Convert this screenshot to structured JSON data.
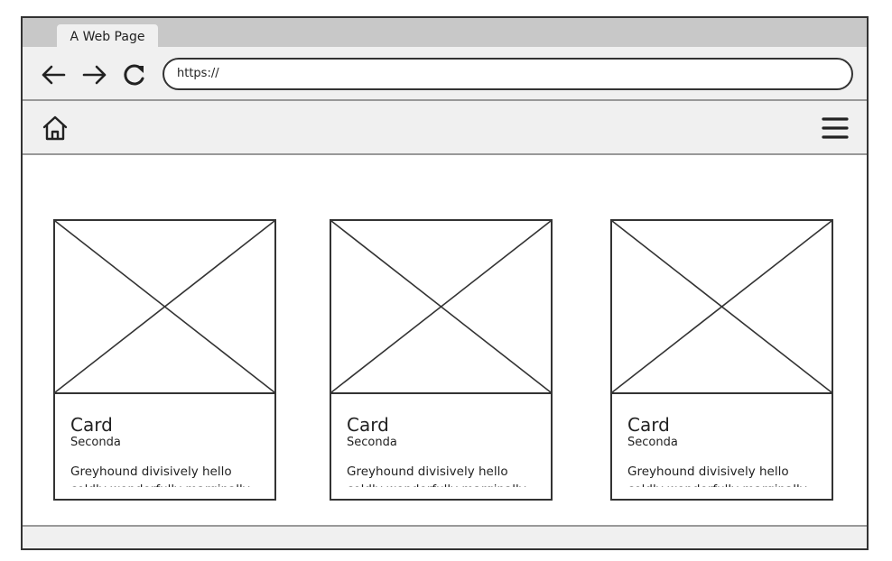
{
  "browser": {
    "tab_title": "A Web Page",
    "url": "https://",
    "nav_icons": [
      "arrow-left-icon",
      "arrow-right-icon",
      "reload-icon"
    ]
  },
  "navbar": {
    "left_icon": "home-icon",
    "right_icon": "hamburger-menu-icon"
  },
  "cards": [
    {
      "title": "Card",
      "subtitle": "Seconda",
      "text": "Greyhound divisively hello coldly wonderfully marginally",
      "image": "image-placeholder"
    },
    {
      "title": "Card",
      "subtitle": "Seconda",
      "text": "Greyhound divisively hello coldly wonderfully marginally",
      "image": "image-placeholder"
    },
    {
      "title": "Card",
      "subtitle": "Seconda",
      "text": "Greyhound divisively hello coldly wonderfully marginally",
      "image": "image-placeholder"
    }
  ]
}
